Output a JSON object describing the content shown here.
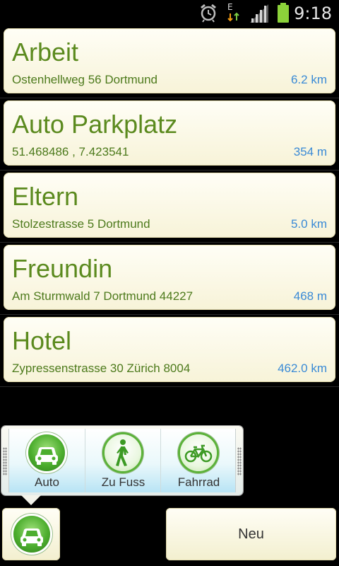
{
  "status_bar": {
    "time": "9:18",
    "network_type": "E",
    "icons": [
      "alarm-icon",
      "data-transfer-icon",
      "signal-icon",
      "battery-icon"
    ]
  },
  "places": [
    {
      "name": "Arbeit",
      "address": "Ostenhellweg 56 Dortmund",
      "distance": "6.2 km"
    },
    {
      "name": "Auto Parkplatz",
      "address": "51.468486 , 7.423541",
      "distance": "354 m"
    },
    {
      "name": "Eltern",
      "address": "Stolzestrasse 5 Dortmund",
      "distance": "5.0 km"
    },
    {
      "name": "Freundin",
      "address": "Am Sturmwald 7 Dortmund 44227",
      "distance": "468 m"
    },
    {
      "name": "Hotel",
      "address": "Zypressenstrasse 30 Zürich 8004",
      "distance": "462.0 km"
    }
  ],
  "mode_popup": {
    "items": [
      {
        "label": "Auto",
        "icon": "car-icon"
      },
      {
        "label": "Zu Fuss",
        "icon": "walking-icon"
      },
      {
        "label": "Fahrrad",
        "icon": "bicycle-icon"
      }
    ]
  },
  "bottom_bar": {
    "mode_button_icon": "car-icon",
    "new_label": "Neu"
  },
  "colors": {
    "title": "#5b8a1e",
    "address": "#4d7a1c",
    "distance": "#3a8ad6",
    "card_bg": "#fbf8e4"
  }
}
